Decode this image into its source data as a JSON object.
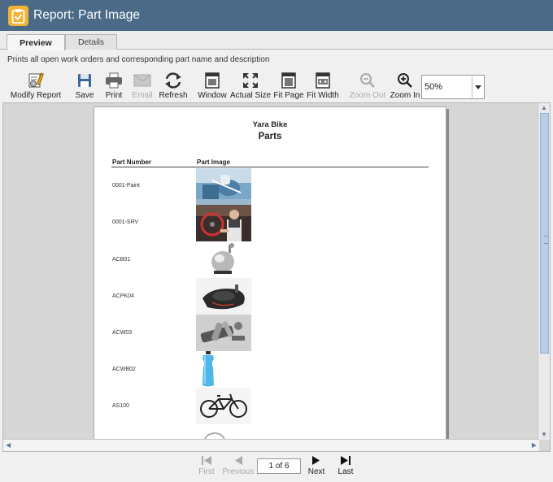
{
  "window": {
    "title": "Report: Part Image"
  },
  "tabs": [
    {
      "label": "Preview"
    },
    {
      "label": "Details"
    }
  ],
  "description": "Prints all open work orders and corresponding part name and description",
  "toolbar": {
    "modify_report": "Modify Report",
    "save": "Save",
    "print": "Print",
    "email": "Email",
    "refresh": "Refresh",
    "window": "Window",
    "actual_size": "Actual Size",
    "fit_page": "Fit Page",
    "fit_width": "Fit Width",
    "zoom_out": "Zoom Out",
    "zoom_in": "Zoom In",
    "zoom_value": "50%"
  },
  "report": {
    "company": "Yara Bike",
    "title": "Parts",
    "col_part_number": "Part Number",
    "col_part_image": "Part Image",
    "rows": [
      {
        "part_number": "0001-Paint",
        "image": "paint-booth-photo"
      },
      {
        "part_number": "0001-SRV",
        "image": "mechanic-photo"
      },
      {
        "part_number": "ACB01",
        "image": "bike-bell-photo"
      },
      {
        "part_number": "ACPK04",
        "image": "saddle-bag-photo"
      },
      {
        "part_number": "ACW03",
        "image": "tool-set-photo"
      },
      {
        "part_number": "ACWB02",
        "image": "water-bottle-photo"
      },
      {
        "part_number": "AS100",
        "image": "bicycle-photo"
      }
    ]
  },
  "nav": {
    "first": "First",
    "previous": "Previous",
    "page_indicator": "1 of 6",
    "next": "Next",
    "last": "Last"
  },
  "colors": {
    "titlebar": "#4a6a87",
    "app_icon": "#f2b233",
    "scroll_thumb": "#b8cde6"
  }
}
